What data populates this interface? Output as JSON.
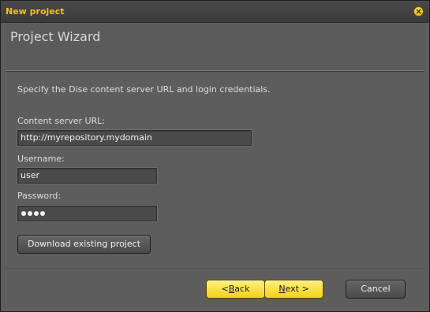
{
  "window": {
    "title": "New project"
  },
  "header": {
    "title": "Project Wizard"
  },
  "instructions": "Specify the Dise content server URL and login credentials.",
  "fields": {
    "server_url": {
      "label": "Content server URL:",
      "value": "http://myrepository.mydomain"
    },
    "username": {
      "label": "Username:",
      "value": "user"
    },
    "password": {
      "label": "Password:",
      "masked_length": 4
    }
  },
  "buttons": {
    "download": "Download existing project",
    "back": {
      "accel": "<",
      "rest": " Back",
      "accel_underline": "B"
    },
    "next": {
      "accel": "N",
      "rest": "ext >"
    },
    "cancel": "Cancel"
  },
  "colors": {
    "title_text": "#f0c020",
    "primary_button": "#f2d21a",
    "background": "#5d5d5d"
  },
  "icons": {
    "close": "close-icon"
  }
}
